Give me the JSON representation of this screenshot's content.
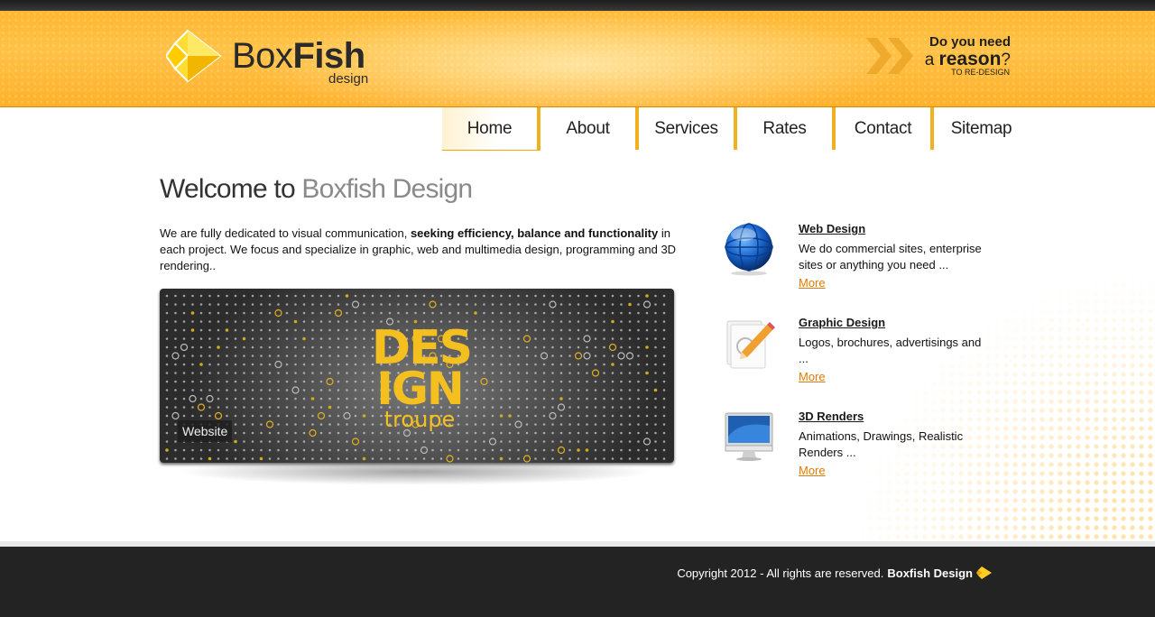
{
  "header": {
    "logo_word_light": "Box",
    "logo_word_bold": "Fish",
    "logo_sub": "design",
    "tagline_line1": "Do you need",
    "tagline_prefix": "a ",
    "tagline_emphasis": "reason",
    "tagline_suffix": "?",
    "tagline_line3": "TO RE-DESIGN"
  },
  "nav": {
    "items": [
      {
        "label": "Home",
        "active": true
      },
      {
        "label": "About"
      },
      {
        "label": "Services"
      },
      {
        "label": "Rates"
      },
      {
        "label": "Contact"
      },
      {
        "label": "Sitemap"
      }
    ]
  },
  "main": {
    "heading_dark": "Welcome to ",
    "heading_light": "Boxfish Design",
    "intro_part1": "We are fully dedicated to visual communication, ",
    "intro_bold": "seeking efficiency, balance and functionality",
    "intro_part2": " in each project. We focus and specialize in graphic, web and multimedia design, programming and 3D rendering..",
    "banner": {
      "line1": "DES",
      "line2": "IGN",
      "line3": "troupe",
      "caption": "Website"
    }
  },
  "services": [
    {
      "title": "Web Design",
      "desc": "We do commercial sites, enterprise sites or anything you need ...",
      "more": "More",
      "icon": "globe-icon"
    },
    {
      "title": "Graphic Design",
      "desc": "Logos, brochures, advertisings and ...",
      "more": "More",
      "icon": "pencil-document-icon"
    },
    {
      "title": "3D Renders",
      "desc": "Animations, Drawings, Realistic Renders ...",
      "more": "More",
      "icon": "monitor-icon"
    }
  ],
  "footer": {
    "copyright_text": "Copyright 2012 - All rights are reserved.",
    "brand": "Boxfish Design"
  },
  "colors": {
    "accent": "#f0b020",
    "header": "#ffb730",
    "link": "#e07a00",
    "footer": "#232323"
  }
}
